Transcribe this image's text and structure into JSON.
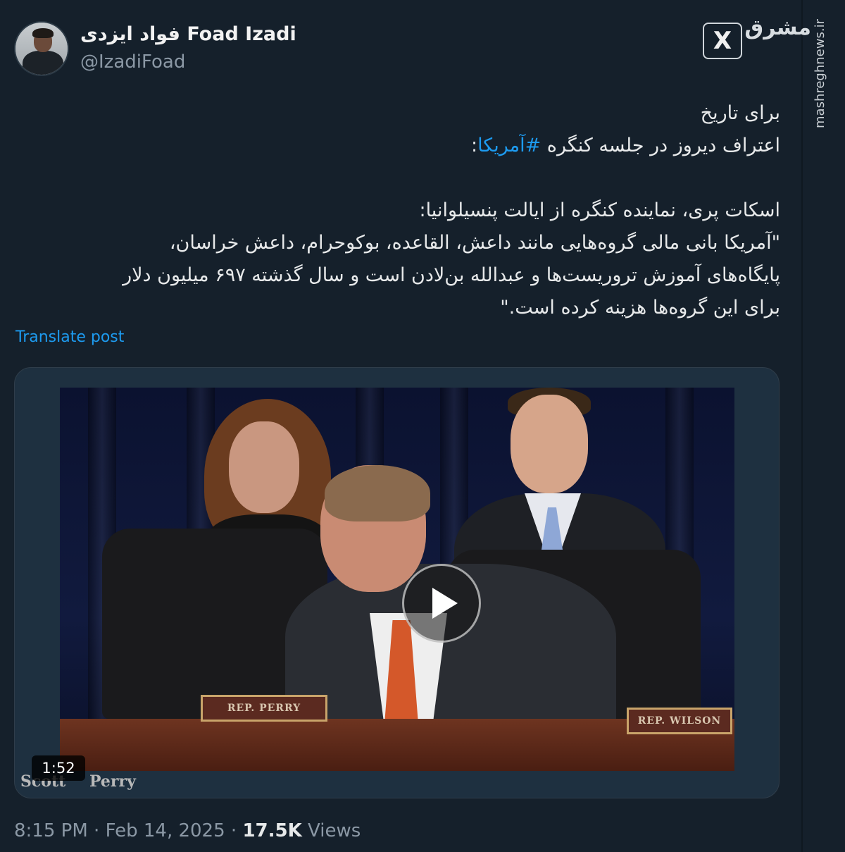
{
  "author": {
    "display_name": "فواد ایزدی Foad Izadi",
    "handle": "@IzadiFoad"
  },
  "watermark": {
    "logo_text": "مشرق",
    "site": "mashreghnews.ir",
    "platform_icon": "x-logo-icon"
  },
  "tweet": {
    "line1": "برای تاریخ",
    "line2_prefix": "اعتراف دیروز در جلسه کنگره",
    "hashtag": "#آمریکا",
    "line2_suffix": ":",
    "line3": "اسکات پری، نماینده کنگره از ایالت پنسیلوانیا:",
    "line4": "\"آمریکا بانی مالی گروه‌هایی مانند داعش، القاعده، بوکوحرام، داعش خراسان،",
    "line5": "پایگاه‌های  آموزش تروریست‌ها و عبدالله بن‌لادن است و سال گذشته ۶۹۷ میلیون دلار",
    "line6": "برای این گروه‌ها هزینه کرده است.\"",
    "translate_label": "Translate post"
  },
  "media": {
    "duration": "1:52",
    "caption": "Scott Perry",
    "nameplate_left": "REP. PERRY",
    "nameplate_right": "REP. WILSON",
    "play_icon": "play-icon"
  },
  "meta": {
    "time": "8:15 PM",
    "separator": "·",
    "date": "Feb 14, 2025",
    "views_count": "17.5K",
    "views_label": "Views"
  },
  "colors": {
    "background": "#15202b",
    "link": "#1d9bf0",
    "muted": "#8b98a5"
  }
}
